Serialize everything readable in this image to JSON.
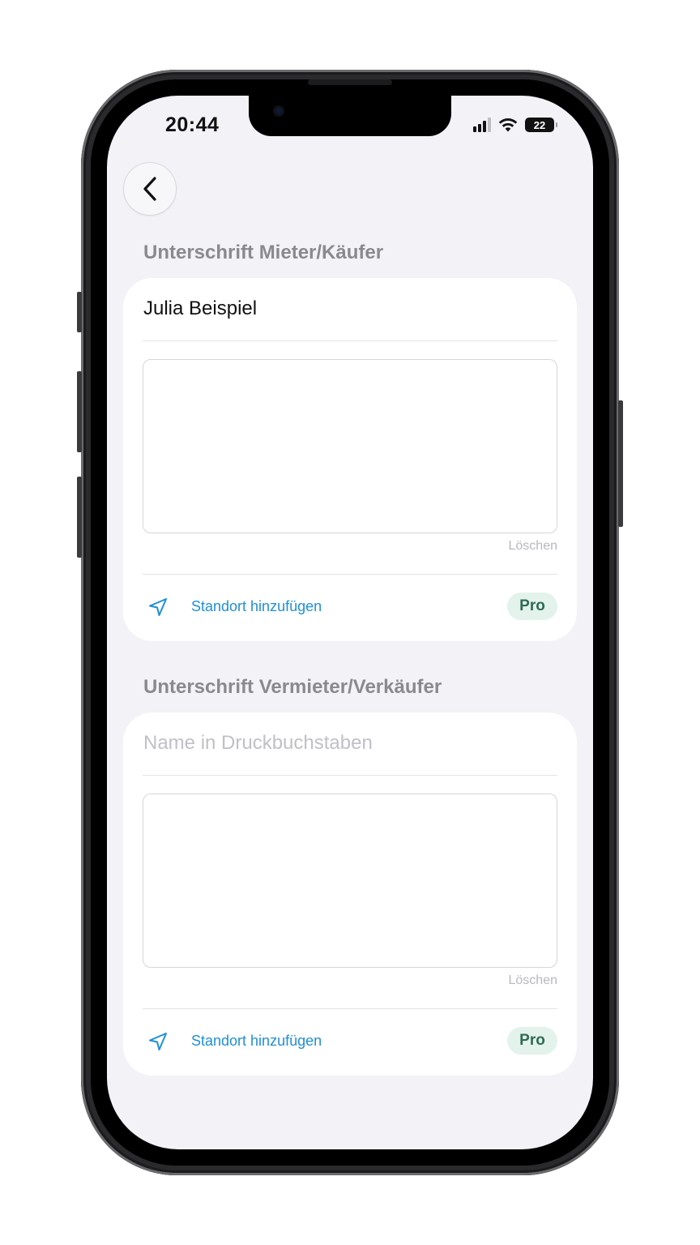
{
  "status_bar": {
    "time": "20:44",
    "battery": "22"
  },
  "sections": [
    {
      "title": "Unterschrift Mieter/Käufer",
      "name_value": "Julia Beispiel",
      "clear_label": "Löschen",
      "location_label": "Standort hinzufügen",
      "pro_badge": "Pro"
    },
    {
      "title": "Unterschrift Vermieter/Verkäufer",
      "name_placeholder": "Name in Druckbuchstaben",
      "clear_label": "Löschen",
      "location_label": "Standort hinzufügen",
      "pro_badge": "Pro"
    }
  ],
  "colors": {
    "background": "#f2f2f7",
    "link_blue": "#1f8fd6",
    "pro_badge_bg": "#e4f2ec",
    "pro_badge_text": "#2e6b55"
  }
}
